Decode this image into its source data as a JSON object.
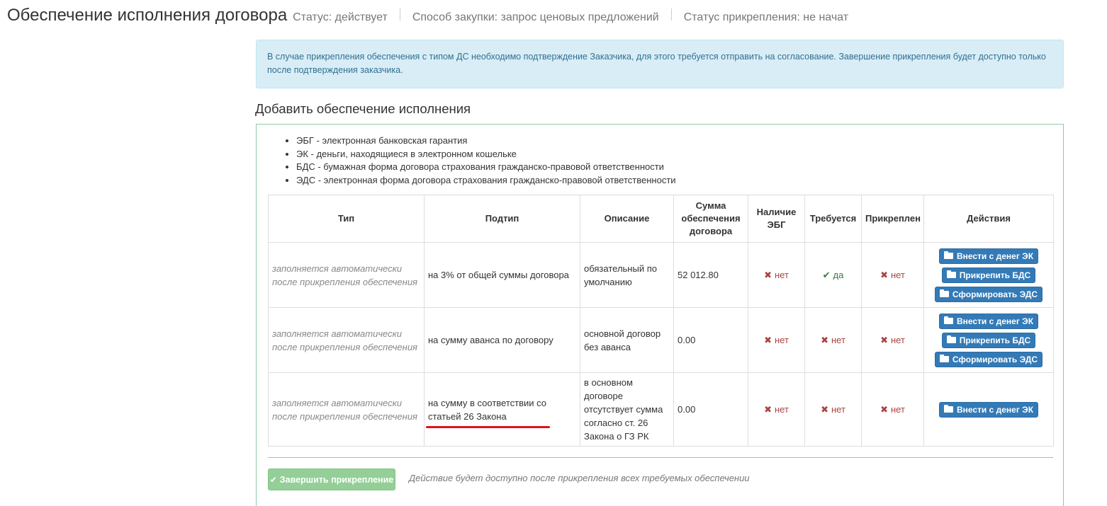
{
  "header": {
    "title": "Обеспечение исполнения договора",
    "status": "Статус: действует",
    "purchase_method": "Способ закупки: запрос ценовых предложений",
    "attach_status": "Статус прикрепления: не начат"
  },
  "alert": {
    "text": "В случае прикрепления обеспечения с типом ДС необходимо подтверждение Заказчика, для этого требуется отправить на согласование. Завершение прикрепления будет доступно только после подтверждения заказчика."
  },
  "section": {
    "title": "Добавить обеспечение исполнения"
  },
  "legend": [
    "ЭБГ - электронная банковская гарантия",
    "ЭК - деньги, находящиеся в электронном кошельке",
    "БДС - бумажная форма договора страхования гражданско-правовой ответственности",
    "ЭДС - электронная форма договора страхования гражданско-правовой ответственности"
  ],
  "table": {
    "headers": [
      "Тип",
      "Подтип",
      "Описание",
      "Сумма обеспечения договора",
      "Наличие ЭБГ",
      "Требуется",
      "Прикреплен",
      "Действия"
    ],
    "rows": [
      {
        "type": "заполняется автоматически после прикрепления обеспечения",
        "subtype": "на 3% от общей суммы договора",
        "description": "обязательный по умолчанию",
        "amount": "52 012.80",
        "ebg": "нет",
        "required": "да",
        "attached": "нет",
        "actions": [
          "Внести с денег ЭК",
          "Прикрепить БДС",
          "Сформировать ЭДС"
        ]
      },
      {
        "type": "заполняется автоматически после прикрепления обеспечения",
        "subtype": "на сумму аванса по договору",
        "description": "основной договор без аванса",
        "amount": "0.00",
        "ebg": "нет",
        "required": "нет",
        "attached": "нет",
        "actions": [
          "Внести с денег ЭК",
          "Прикрепить БДС",
          "Сформировать ЭДС"
        ]
      },
      {
        "type": "заполняется автоматически после прикрепления обеспечения",
        "subtype": "на сумму в соответствии со статьей 26 Закона",
        "description": "в основном договоре отсутствует сумма согласно ст. 26 Закона о ГЗ РК",
        "amount": "0.00",
        "ebg": "нет",
        "required": "нет",
        "attached": "нет",
        "actions": [
          "Внести с денег ЭК"
        ]
      }
    ]
  },
  "footer": {
    "finish_label": "Завершить прикрепление",
    "note": "Действие будет доступно после прикрепления всех требуемых обеспечении"
  },
  "icons": {
    "cross": "✖",
    "check": "✔",
    "folder": "folder-open-icon"
  },
  "colors": {
    "primary": "#337ab7",
    "danger": "#a94442",
    "success": "#3c763d",
    "alert_bg": "#d9edf7",
    "panel_border": "#8fc9a8",
    "annotation": "#e0121b"
  }
}
